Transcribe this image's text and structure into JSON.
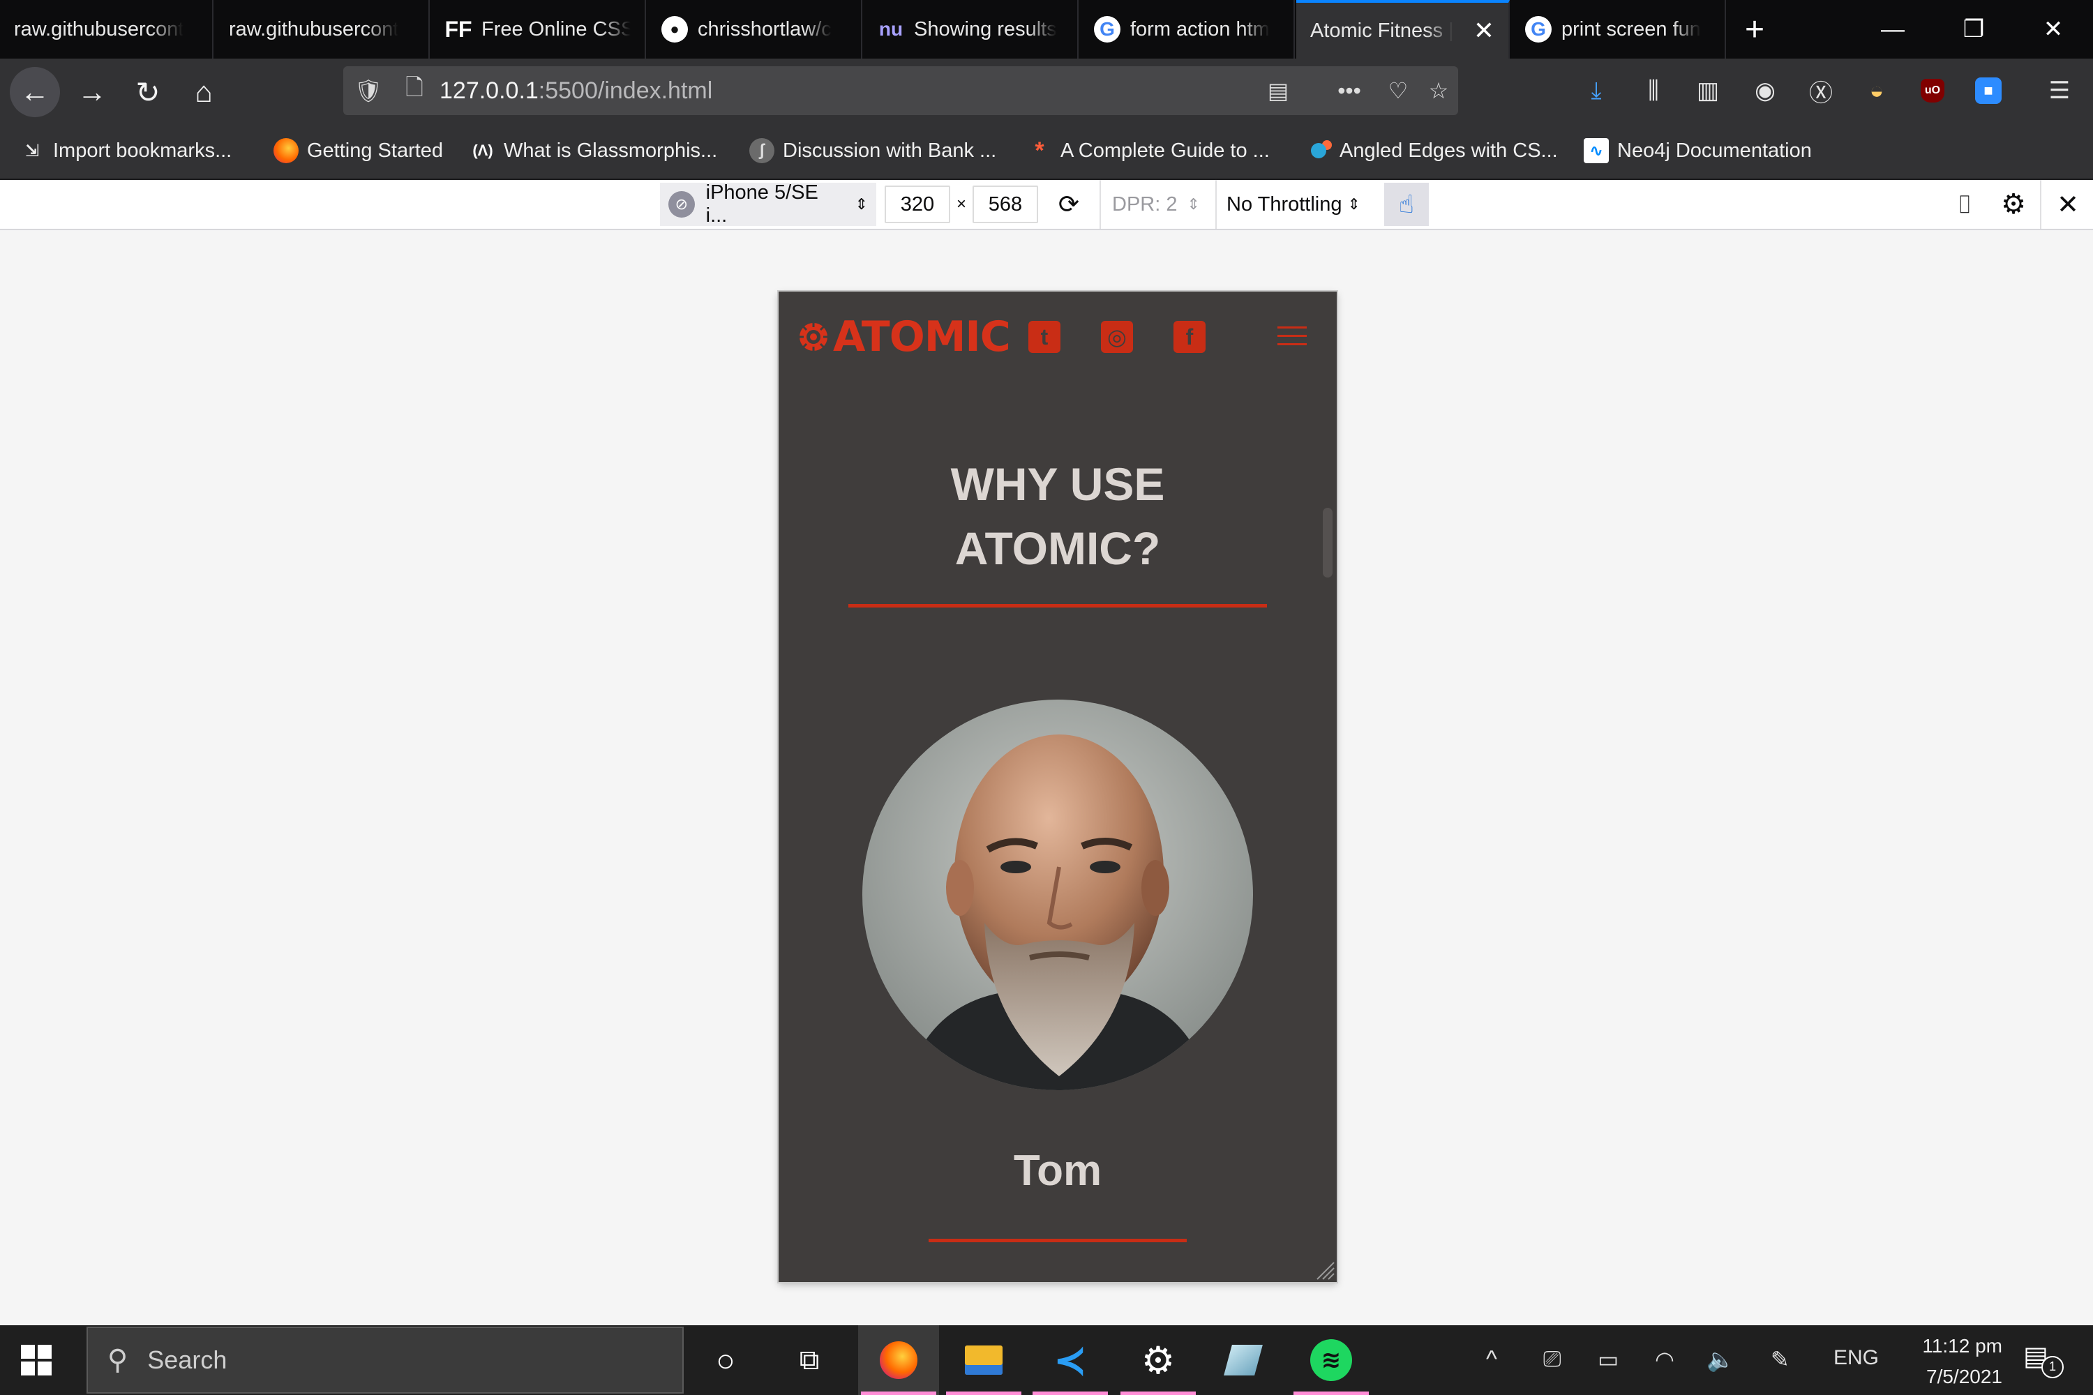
{
  "browser": {
    "tabs": [
      {
        "title": "raw.githubusercont",
        "icon": "none"
      },
      {
        "title": "raw.githubusercont",
        "icon": "none"
      },
      {
        "title": "Free Online CSS",
        "icon": "ff-icon"
      },
      {
        "title": "chrisshortlaw/c",
        "icon": "github-icon"
      },
      {
        "title": "Showing results",
        "icon": "nu-icon"
      },
      {
        "title": "form action htm",
        "icon": "google-icon"
      },
      {
        "title": "Atomic Fitness |",
        "icon": "none",
        "active": true
      },
      {
        "title": "print screen fun",
        "icon": "google-icon"
      }
    ],
    "url_host": "127.0.0.1",
    "url_path": ":5500/index.html",
    "bookmarks": [
      {
        "label": "Import bookmarks...",
        "icon": "import-icon"
      },
      {
        "label": "Getting Started",
        "icon": "firefox-icon"
      },
      {
        "label": "What is Glassmorphis...",
        "icon": "glass-icon"
      },
      {
        "label": "Discussion with Bank ...",
        "icon": "discussion-icon"
      },
      {
        "label": "A Complete Guide to ...",
        "icon": "asterisk-icon"
      },
      {
        "label": "Angled Edges with CS...",
        "icon": "dot-icon"
      },
      {
        "label": "Neo4j Documentation",
        "icon": "neo4j-icon"
      }
    ]
  },
  "responsive_mode": {
    "device": "iPhone 5/SE i...",
    "width": "320",
    "times": "×",
    "height": "568",
    "dpr": "DPR: 2",
    "throttling": "No Throttling"
  },
  "site": {
    "logo_text": "ATOMIC",
    "social": [
      {
        "name": "twitter",
        "glyph": "t"
      },
      {
        "name": "instagram",
        "glyph": "◎"
      },
      {
        "name": "facebook",
        "glyph": "f"
      }
    ],
    "heading_line1": "WHY USE",
    "heading_line2": "ATOMIC?",
    "trainer_name": "Tom",
    "accent_color": "#c92d15",
    "background_color": "#403d3c"
  },
  "taskbar": {
    "search_placeholder": "Search",
    "language": "ENG",
    "time": "11:12 pm",
    "date": "7/5/2021",
    "notification_count": "1"
  }
}
